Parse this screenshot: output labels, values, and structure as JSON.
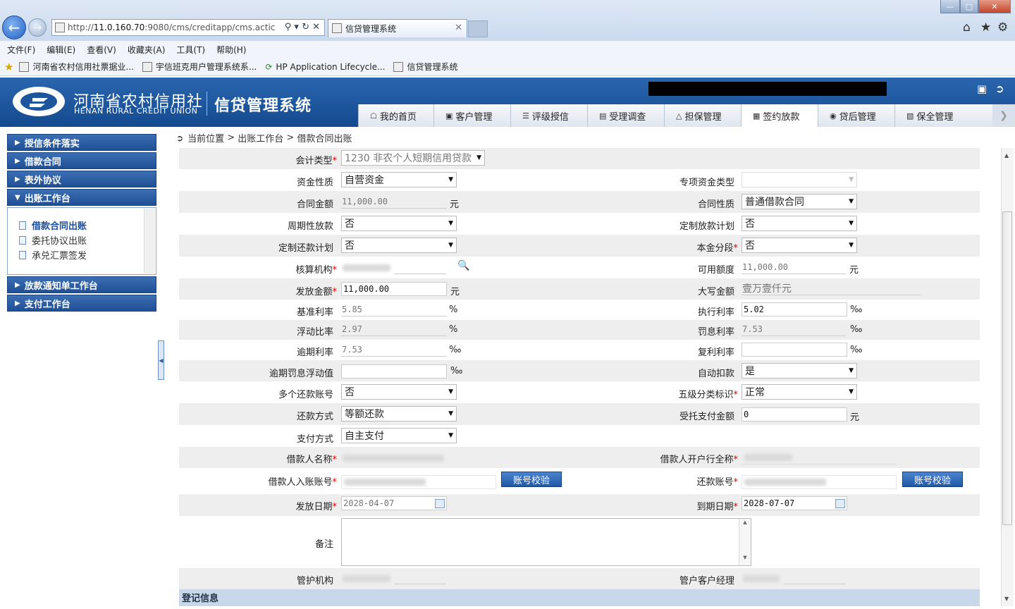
{
  "browser": {
    "url_prefix": "http://",
    "url_host": "11.0.160.70",
    "url_rest": ":9080/cms/creditapp/cms.actic",
    "tab_title": "信贷管理系统",
    "menu": [
      "文件(F)",
      "编辑(E)",
      "查看(V)",
      "收藏夹(A)",
      "工具(T)",
      "帮助(H)"
    ],
    "favorites": [
      "河南省农村信用社票据业...",
      "宇信班克用户管理系统系...",
      "HP Application Lifecycle...",
      "信贷管理系统"
    ]
  },
  "app": {
    "brand_cn": "河南省农村信用社",
    "brand_en": "HENAN RURAL CREDIT UNION",
    "system_name": "信贷管理系统",
    "nav_tabs": [
      "我的首页",
      "客户管理",
      "评级授信",
      "受理调查",
      "担保管理",
      "签约放款",
      "贷后管理",
      "保全管理"
    ],
    "active_tab": "签约放款"
  },
  "sidebar": {
    "sections": [
      "授信条件落实",
      "借款合同",
      "表外协议",
      "出账工作台"
    ],
    "sub_items": [
      "借款合同出账",
      "委托协议出账",
      "承兑汇票签发"
    ],
    "sections_after": [
      "放款通知单工作台",
      "支付工作台"
    ]
  },
  "breadcrumb": {
    "label": "当前位置",
    "path1": "出账工作台",
    "path2": "借款合同出账",
    "sep": ">"
  },
  "form": {
    "accounting_type": {
      "label": "会计类型",
      "value": "1230 非农个人短期信用贷款"
    },
    "fund_nature": {
      "label": "资金性质",
      "value": "自营资金"
    },
    "special_fund_type": {
      "label": "专项资金类型",
      "value": ""
    },
    "contract_amount": {
      "label": "合同金额",
      "value": "11,000.00",
      "unit": "元"
    },
    "contract_nature": {
      "label": "合同性质",
      "value": "普通借款合同"
    },
    "periodic_loan": {
      "label": "周期性放款",
      "value": "否"
    },
    "custom_loan_plan": {
      "label": "定制放款计划",
      "value": "否"
    },
    "custom_repay_plan": {
      "label": "定制还款计划",
      "value": "否"
    },
    "principal_segment": {
      "label": "本金分段",
      "value": "否"
    },
    "accounting_org": {
      "label": "核算机构"
    },
    "available_amount": {
      "label": "可用额度",
      "value": "11,000.00",
      "unit": "元"
    },
    "loan_amount": {
      "label": "发放金额",
      "value": "11,000.00",
      "unit": "元"
    },
    "amount_in_words": {
      "label": "大写金额",
      "value": "壹万壹仟元"
    },
    "base_rate": {
      "label": "基准利率",
      "value": "5.85",
      "unit": "%"
    },
    "exec_rate": {
      "label": "执行利率",
      "value": "5.02",
      "unit": "‰"
    },
    "float_ratio": {
      "label": "浮动比率",
      "value": "2.97",
      "unit": "%"
    },
    "penalty_rate": {
      "label": "罚息利率",
      "value": "7.53",
      "unit": "‰"
    },
    "overdue_rate": {
      "label": "逾期利率",
      "value": "7.53",
      "unit": "‰"
    },
    "compound_rate": {
      "label": "复利利率",
      "value": "",
      "unit": "‰"
    },
    "overdue_float": {
      "label": "逾期罚息浮动值",
      "value": "",
      "unit": "‰"
    },
    "auto_deduct": {
      "label": "自动扣款",
      "value": "是"
    },
    "multi_repay_acct": {
      "label": "多个还款账号",
      "value": "否"
    },
    "five_class": {
      "label": "五级分类标识",
      "value": "正常"
    },
    "repay_method": {
      "label": "还款方式",
      "value": "等额还款"
    },
    "entrusted_pay_amount": {
      "label": "受托支付金额",
      "value": "0",
      "unit": "元"
    },
    "pay_method": {
      "label": "支付方式",
      "value": "自主支付"
    },
    "borrower_name": {
      "label": "借款人名称"
    },
    "borrower_bank": {
      "label": "借款人开户行全称"
    },
    "borrower_acct": {
      "label": "借款人入账账号"
    },
    "repay_acct": {
      "label": "还款账号"
    },
    "verify_btn": "账号校验",
    "issue_date": {
      "label": "发放日期",
      "value": "2028-04-07"
    },
    "due_date": {
      "label": "到期日期",
      "value": "2028-07-07"
    },
    "remark": {
      "label": "备注",
      "value": ""
    },
    "custody_org": {
      "label": "管护机构"
    },
    "account_manager": {
      "label": "管户客户经理"
    },
    "register_section": "登记信息"
  }
}
